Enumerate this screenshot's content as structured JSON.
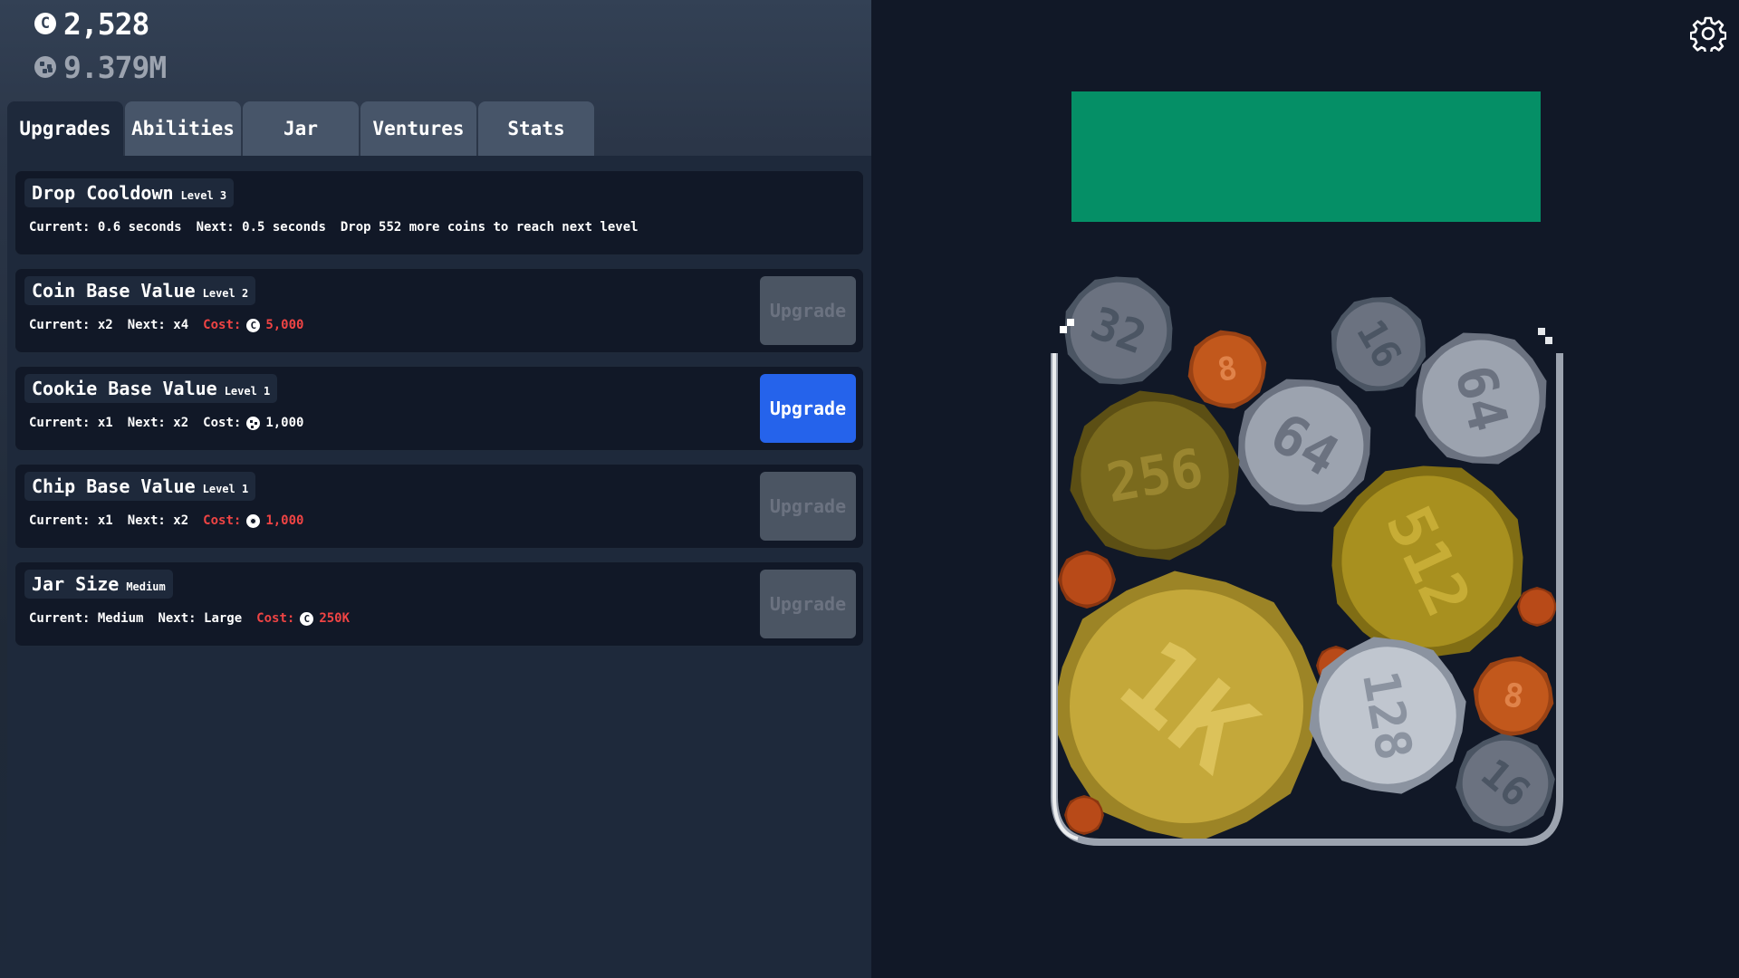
{
  "header": {
    "coins": "2,528",
    "cookies": "9.379M"
  },
  "tabs": [
    {
      "label": "Upgrades",
      "active": true
    },
    {
      "label": "Abilities",
      "active": false
    },
    {
      "label": "Jar",
      "active": false
    },
    {
      "label": "Ventures",
      "active": false
    },
    {
      "label": "Stats",
      "active": false
    }
  ],
  "upgrades": [
    {
      "name": "Drop Cooldown",
      "level": "Level 3",
      "current": "Current: 0.6 seconds",
      "next": "Next: 0.5 seconds",
      "note": "Drop 552 more coins to reach next level"
    },
    {
      "name": "Coin Base Value",
      "level": "Level 2",
      "current": "Current: x2",
      "next": "Next: x4",
      "cost_label": "Cost:",
      "cost_currency": "coin-icon",
      "cost_value": "5,000",
      "button_label": "Upgrade",
      "affordable": false
    },
    {
      "name": "Cookie Base Value",
      "level": "Level 1",
      "current": "Current: x1",
      "next": "Next: x2",
      "cost_label": "Cost:",
      "cost_currency": "cookie-icon",
      "cost_value": "1,000",
      "button_label": "Upgrade",
      "affordable": true
    },
    {
      "name": "Chip Base Value",
      "level": "Level 1",
      "current": "Current: x1",
      "next": "Next: x2",
      "cost_label": "Cost:",
      "cost_currency": "chip-icon",
      "cost_value": "1,000",
      "button_label": "Upgrade",
      "affordable": false
    },
    {
      "name": "Jar Size",
      "level": "Medium",
      "current": "Current: Medium",
      "next": "Next: Large",
      "cost_label": "Cost:",
      "cost_currency": "coin-icon",
      "cost_value": "250K",
      "button_label": "Upgrade",
      "affordable": false
    }
  ],
  "jar": {
    "coins": [
      {
        "value": "32",
        "metal": "silver-dark"
      },
      {
        "value": "8",
        "metal": "copper"
      },
      {
        "value": "16",
        "metal": "silver-dark"
      },
      {
        "value": "64",
        "metal": "silver"
      },
      {
        "value": "64",
        "metal": "silver"
      },
      {
        "value": "256",
        "metal": "gold-dark"
      },
      {
        "value": "512",
        "metal": "gold"
      },
      {
        "value": "",
        "metal": "copper-small"
      },
      {
        "value": "",
        "metal": "copper-small"
      },
      {
        "value": "1K",
        "metal": "gold-light"
      },
      {
        "value": "",
        "metal": "copper-small"
      },
      {
        "value": "128",
        "metal": "silver-light"
      },
      {
        "value": "8",
        "metal": "copper"
      },
      {
        "value": "16",
        "metal": "silver-dark"
      },
      {
        "value": "",
        "metal": "copper-small"
      }
    ]
  },
  "colors": {
    "accent": "#2563eb",
    "drop_zone": "#059669",
    "unaffordable": "#ef4444",
    "panel": "#1e293b",
    "card": "#111827"
  }
}
